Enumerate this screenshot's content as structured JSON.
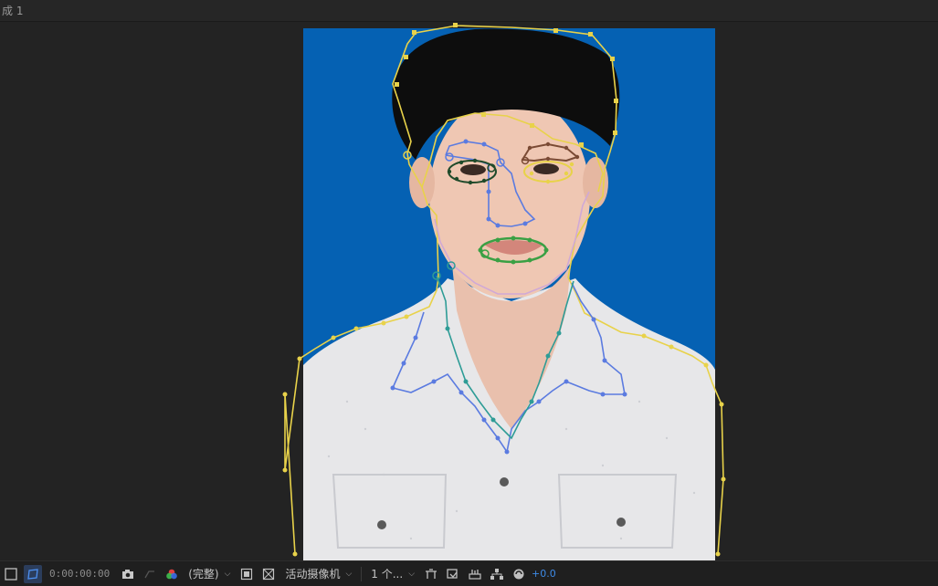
{
  "window": {
    "tab_label": "成 1"
  },
  "toolbar": {
    "timecode": "0:00:00:00",
    "resolution_label": "(完整)",
    "camera_label": "活动摄像机",
    "views_label": "1 个...",
    "exposure_value": "+0.0"
  },
  "icons": {
    "region": "region-of-interest-icon",
    "mask": "mask-visibility-icon",
    "snapshot": "camera-snapshot-icon",
    "show_snapshot": "show-snapshot-icon",
    "color": "color-channels-icon",
    "fast_preview": "fast-preview-icon",
    "transparency": "transparency-grid-icon",
    "flowchart": "flowchart-icon",
    "reset_exposure": "reset-exposure-icon"
  },
  "colors": {
    "photo_background": "#0561b3",
    "outline_body": "#e8d24a",
    "outline_collar": "#5b7be0",
    "outline_neck": "#2e9c96",
    "outline_mouth": "#3aa044",
    "outline_eye_left": "#1f4a2a",
    "outline_brow_right": "#7a4a34",
    "outline_nose": "#5b7be0",
    "outline_chin": "#d0a9d6",
    "accent": "#3d8be8"
  }
}
